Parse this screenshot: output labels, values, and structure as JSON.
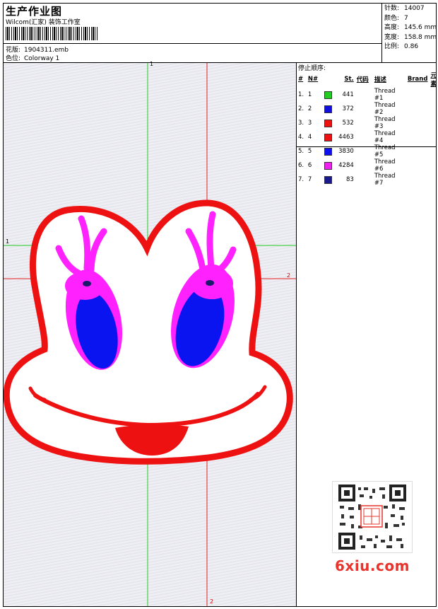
{
  "header": {
    "title": "生产作业图",
    "company": "Wilcom(汇家) 装饰工作室",
    "design_label": "花版:",
    "design_value": "1904311.emb",
    "colorway_label": "色位:",
    "colorway_value": "Colorway 1"
  },
  "stats": [
    {
      "label": "针数:",
      "value": "14007"
    },
    {
      "label": "颜色:",
      "value": "7"
    },
    {
      "label": "高度:",
      "value": "145.6 mm"
    },
    {
      "label": "宽度:",
      "value": "158.8 mm"
    },
    {
      "label": "比例:",
      "value": "0.86"
    }
  ],
  "thread_table": {
    "title": "停止顺序:",
    "headers": [
      "#",
      "N#",
      "",
      "St.",
      "代码",
      "描述",
      "Brand",
      "元素"
    ],
    "rows": [
      {
        "idx": "1.",
        "n": "1",
        "color": "#22cc22",
        "st": "441",
        "code": "",
        "desc": "Thread #1"
      },
      {
        "idx": "2.",
        "n": "2",
        "color": "#1010dd",
        "st": "372",
        "code": "",
        "desc": "Thread #2"
      },
      {
        "idx": "3.",
        "n": "3",
        "color": "#ee1111",
        "st": "532",
        "code": "",
        "desc": "Thread #3"
      },
      {
        "idx": "4.",
        "n": "4",
        "color": "#ee1111",
        "st": "4463",
        "code": "",
        "desc": "Thread #4"
      },
      {
        "idx": "5.",
        "n": "5",
        "color": "#1010ee",
        "st": "3830",
        "code": "",
        "desc": "Thread #5"
      },
      {
        "idx": "6.",
        "n": "6",
        "color": "#ee22ee",
        "st": "4284",
        "code": "",
        "desc": "Thread #6"
      },
      {
        "idx": "7.",
        "n": "7",
        "color": "#1a1a8c",
        "st": "83",
        "code": "",
        "desc": "Thread #7"
      }
    ]
  },
  "guides": {
    "top_green": "1",
    "left_green": "1",
    "right_red": "2",
    "bottom_red": "2"
  },
  "colors": {
    "outline": "#ee1111",
    "eyelid": "#ff22ff",
    "pupil": "#0a14f0",
    "guide_green": "#22cc22",
    "guide_red": "#e02020",
    "watermark": "#e8342c"
  },
  "watermark": {
    "site": "6xiu.com"
  }
}
